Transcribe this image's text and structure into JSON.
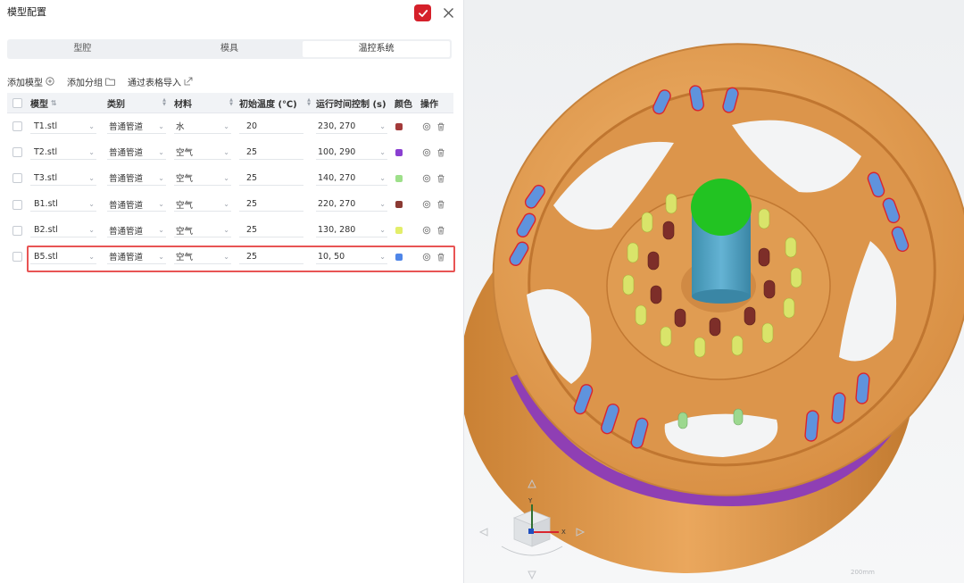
{
  "panel": {
    "title": "模型配置",
    "tabs": [
      "型腔",
      "模具",
      "温控系统"
    ],
    "active_tab": 2,
    "actions": {
      "add_model": "添加模型",
      "add_group": "添加分组",
      "import_table": "通过表格导入"
    },
    "columns": {
      "model": "模型",
      "category": "类别",
      "material": "材料",
      "init_temp": "初始温度 (℃)",
      "runtime": "运行时间控制 (s)",
      "color": "颜色",
      "ops": "操作"
    },
    "rows": [
      {
        "model": "T1.stl",
        "category": "普通管道",
        "material": "水",
        "init_temp": "20",
        "runtime": "230, 270",
        "color": "#a33a3a"
      },
      {
        "model": "T2.stl",
        "category": "普通管道",
        "material": "空气",
        "init_temp": "25",
        "runtime": "100, 290",
        "color": "#8a3fd1"
      },
      {
        "model": "T3.stl",
        "category": "普通管道",
        "material": "空气",
        "init_temp": "25",
        "runtime": "140, 270",
        "color": "#9ee08a"
      },
      {
        "model": "B1.stl",
        "category": "普通管道",
        "material": "空气",
        "init_temp": "25",
        "runtime": "220, 270",
        "color": "#8b3a33"
      },
      {
        "model": "B2.stl",
        "category": "普通管道",
        "material": "空气",
        "init_temp": "25",
        "runtime": "130, 280",
        "color": "#e3ee6a"
      },
      {
        "model": "B5.stl",
        "category": "普通管道",
        "material": "空气",
        "init_temp": "25",
        "runtime": "10, 50",
        "color": "#4f86e8"
      }
    ],
    "highlighted_row": 5
  },
  "viewport": {
    "wheel_color": "#e8a35c",
    "axis_labels": {
      "x": "X",
      "y": "Y"
    },
    "scale_label": "200mm"
  }
}
